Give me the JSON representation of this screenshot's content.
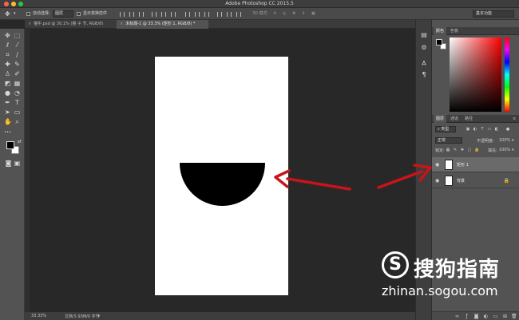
{
  "window": {
    "title": "Adobe Photoshop CC 2015.5",
    "traffic_colors": [
      "#ff5f57",
      "#febc2e",
      "#28c840"
    ]
  },
  "options_bar": {
    "auto_select_label": "自动选择:",
    "auto_select_value": "图层",
    "show_transform_label": "显示变换控件",
    "mode_3d_label": "3D 模式:",
    "workspace": "基本功能"
  },
  "tabs": [
    {
      "label": "猫牛.psd @ 30.1% (猴 子 节, RGB/8)",
      "active": false
    },
    {
      "label": "未标题-1 @ 33.3% (矩形 1, RGB/8) *",
      "active": true
    }
  ],
  "tools": [
    "move-icon",
    "marquee-icon",
    "lasso-icon",
    "magic-wand-icon",
    "crop-icon",
    "eyedropper-icon",
    "healing-icon",
    "brush-icon",
    "stamp-icon",
    "history-brush-icon",
    "eraser-icon",
    "gradient-icon",
    "blur-icon",
    "dodge-icon",
    "pen-icon",
    "type-icon",
    "path-select-icon",
    "rectangle-icon",
    "hand-icon",
    "zoom-icon"
  ],
  "status": {
    "zoom": "33.33%",
    "doc_info": "文档:5.93M/0 字节"
  },
  "color_panel": {
    "tabs": [
      "颜色",
      "色板"
    ]
  },
  "layers_panel": {
    "tabs": [
      "图层",
      "通道",
      "路径"
    ],
    "filter_label": "类型",
    "blend_mode": "正常",
    "opacity_label": "不透明度:",
    "opacity_value": "100%",
    "lock_label": "锁定:",
    "fill_label": "填充:",
    "fill_value": "100%",
    "layers": [
      {
        "name": "矩形 1",
        "selected": true,
        "locked": false
      },
      {
        "name": "背景",
        "selected": false,
        "locked": true
      }
    ]
  },
  "watermark": {
    "name": "搜狗指南",
    "url": "zhinan.sogou.com"
  },
  "colors": {
    "annotation_arrow": "#c8141a"
  }
}
